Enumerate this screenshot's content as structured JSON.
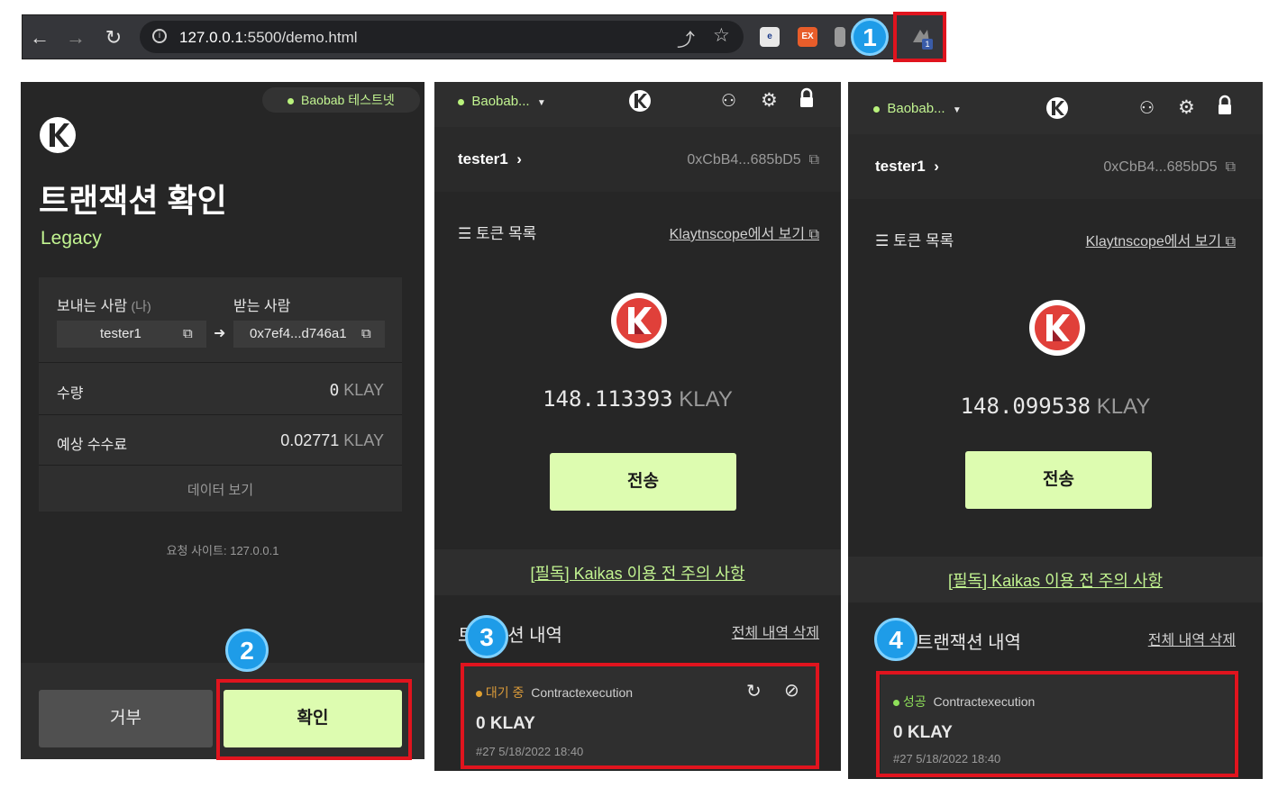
{
  "browser": {
    "url_host": "127.0.0.1",
    "url_rest": ":5500/demo.html",
    "ext_ex": "EX",
    "ext_count": "1"
  },
  "callouts": [
    "1",
    "2",
    "3",
    "4"
  ],
  "confirm": {
    "network": "Baobab 테스트넷",
    "title": "트랜잭션 확인",
    "subtitle": "Legacy",
    "from_label": "보내는 사람",
    "from_suffix": "(나)",
    "to_label": "받는 사람",
    "from_value": "tester1",
    "to_value": "0x7ef4...d746a1",
    "amount_label": "수량",
    "amount_value": "0",
    "amount_unit": "KLAY",
    "fee_label": "예상 수수료",
    "fee_value": "0.02771",
    "fee_unit": "KLAY",
    "data_label": "데이터 보기",
    "site_label": "요청 사이트:",
    "site_value": "127.0.0.1",
    "reject": "거부",
    "confirm": "확인"
  },
  "wallet_a": {
    "network": "Baobab...",
    "account": "tester1",
    "address": "0xCbB4...685bD5",
    "token_list": "토큰 목록",
    "scope_link": "Klaytnscope에서 보기",
    "balance": "148.113393",
    "unit": "KLAY",
    "send": "전송",
    "notice": "[필독] Kaikas 이용 전 주의 사항",
    "history_title": "트랜잭션 내역",
    "history_clear": "전체 내역 삭제",
    "tx": {
      "status": "대기 중",
      "type": "Contractexecution",
      "amount": "0 KLAY",
      "meta": "#27 5/18/2022 18:40"
    }
  },
  "wallet_b": {
    "network": "Baobab...",
    "account": "tester1",
    "address": "0xCbB4...685bD5",
    "token_list": "토큰 목록",
    "scope_link": "Klaytnscope에서 보기",
    "balance": "148.099538",
    "unit": "KLAY",
    "send": "전송",
    "notice": "[필독] Kaikas 이용 전 주의 사항",
    "history_title": "트랜잭션 내역",
    "history_clear": "전체 내역 삭제",
    "tx": {
      "status": "성공",
      "type": "Contractexecution",
      "amount": "0 KLAY",
      "meta": "#27 5/18/2022 18:40"
    }
  },
  "colors": {
    "accent_green": "#ddfcb0",
    "status_pending": "#e0a030",
    "status_success": "#8fe05a",
    "highlight_red": "#e0141e",
    "callout_blue": "#1e9ce8"
  }
}
